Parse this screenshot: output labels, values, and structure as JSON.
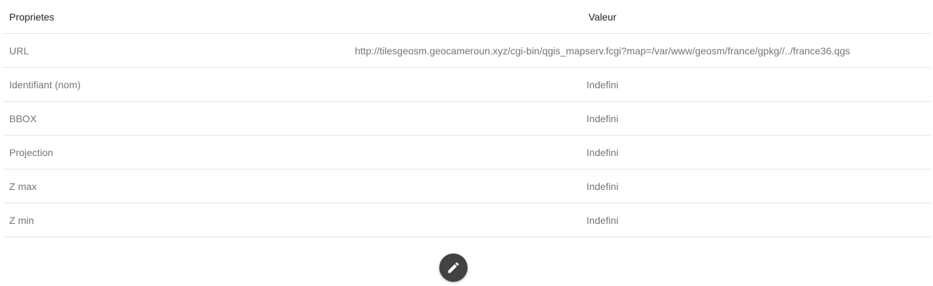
{
  "table": {
    "headers": {
      "property": "Proprietes",
      "value": "Valeur"
    },
    "rows": [
      {
        "key": "URL",
        "value": "http://tilesgeosm.geocameroun.xyz/cgi-bin/qgis_mapserv.fcgi?map=/var/www/geosm/france/gpkg//../france36.qgs"
      },
      {
        "key": "Identifiant (nom)",
        "value": "Indefini"
      },
      {
        "key": "BBOX",
        "value": "Indefini"
      },
      {
        "key": "Projection",
        "value": "Indefini"
      },
      {
        "key": "Z max",
        "value": "Indefini"
      },
      {
        "key": "Z min",
        "value": "Indefini"
      }
    ]
  },
  "actions": {
    "edit_icon": "pencil-icon"
  },
  "colors": {
    "header_text": "#222222",
    "cell_text": "#757575",
    "divider": "#e6e6e6",
    "fab_background": "#424242",
    "fab_icon": "#ffffff"
  }
}
